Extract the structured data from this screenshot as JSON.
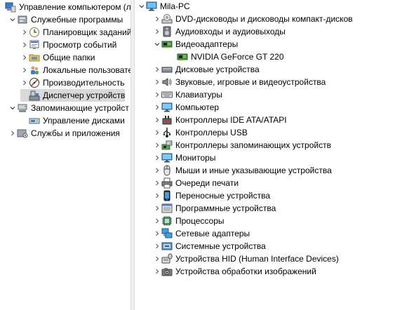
{
  "left_tree": [
    {
      "label": "Управление компьютером (л",
      "expander": "none",
      "icon": "computer-management-icon",
      "indent": 0,
      "selected": false
    },
    {
      "label": "Служебные программы",
      "expander": "expanded",
      "icon": "tools-icon",
      "indent": 1,
      "selected": false
    },
    {
      "label": "Планировщик заданий",
      "expander": "collapsed",
      "icon": "clock-icon",
      "indent": 2,
      "selected": false
    },
    {
      "label": "Просмотр событий",
      "expander": "collapsed",
      "icon": "event-viewer-icon",
      "indent": 2,
      "selected": false
    },
    {
      "label": "Общие папки",
      "expander": "collapsed",
      "icon": "shared-folder-icon",
      "indent": 2,
      "selected": false
    },
    {
      "label": "Локальные пользовате",
      "expander": "collapsed",
      "icon": "users-icon",
      "indent": 2,
      "selected": false
    },
    {
      "label": "Производительность",
      "expander": "collapsed",
      "icon": "performance-icon",
      "indent": 2,
      "selected": false
    },
    {
      "label": "Диспетчер устройств",
      "expander": "none",
      "icon": "device-manager-icon",
      "indent": 2,
      "selected": true
    },
    {
      "label": "Запоминающие устройст",
      "expander": "expanded",
      "icon": "storage-icon",
      "indent": 1,
      "selected": false
    },
    {
      "label": "Управление дисками",
      "expander": "none",
      "icon": "disk-management-icon",
      "indent": 2,
      "selected": false
    },
    {
      "label": "Службы и приложения",
      "expander": "collapsed",
      "icon": "services-icon",
      "indent": 1,
      "selected": false
    }
  ],
  "device_tree": [
    {
      "label": "Mila-PC",
      "expander": "expanded",
      "icon": "computer-icon",
      "indent": 0
    },
    {
      "label": "DVD-дисководы и дисководы компакт-дисков",
      "expander": "collapsed",
      "icon": "dvd-drive-icon",
      "indent": 1
    },
    {
      "label": "Аудиовходы и аудиовыходы",
      "expander": "collapsed",
      "icon": "speaker-icon",
      "indent": 1
    },
    {
      "label": "Видеоадаптеры",
      "expander": "expanded",
      "icon": "display-adapter-icon",
      "indent": 1
    },
    {
      "label": "NVIDIA GeForce GT 220",
      "expander": "none",
      "icon": "display-adapter-icon",
      "indent": 2
    },
    {
      "label": "Дисковые устройства",
      "expander": "collapsed",
      "icon": "disk-drive-icon",
      "indent": 1
    },
    {
      "label": "Звуковые, игровые и видеоустройства",
      "expander": "collapsed",
      "icon": "sound-icon",
      "indent": 1
    },
    {
      "label": "Клавиатуры",
      "expander": "collapsed",
      "icon": "keyboard-icon",
      "indent": 1
    },
    {
      "label": "Компьютер",
      "expander": "collapsed",
      "icon": "monitor-icon",
      "indent": 1
    },
    {
      "label": "Контроллеры IDE ATA/ATAPI",
      "expander": "collapsed",
      "icon": "ide-controller-icon",
      "indent": 1
    },
    {
      "label": "Контроллеры USB",
      "expander": "collapsed",
      "icon": "usb-icon",
      "indent": 1
    },
    {
      "label": "Контроллеры запоминающих устройств",
      "expander": "collapsed",
      "icon": "storage-controller-icon",
      "indent": 1
    },
    {
      "label": "Мониторы",
      "expander": "collapsed",
      "icon": "monitor-icon",
      "indent": 1
    },
    {
      "label": "Мыши и иные указывающие устройства",
      "expander": "collapsed",
      "icon": "mouse-icon",
      "indent": 1
    },
    {
      "label": "Очереди печати",
      "expander": "collapsed",
      "icon": "printer-icon",
      "indent": 1
    },
    {
      "label": "Переносные устройства",
      "expander": "collapsed",
      "icon": "portable-device-icon",
      "indent": 1
    },
    {
      "label": "Программные устройства",
      "expander": "collapsed",
      "icon": "software-device-icon",
      "indent": 1
    },
    {
      "label": "Процессоры",
      "expander": "collapsed",
      "icon": "processor-icon",
      "indent": 1
    },
    {
      "label": "Сетевые адаптеры",
      "expander": "collapsed",
      "icon": "network-adapter-icon",
      "indent": 1
    },
    {
      "label": "Системные устройства",
      "expander": "collapsed",
      "icon": "system-device-icon",
      "indent": 1
    },
    {
      "label": "Устройства HID (Human Interface Devices)",
      "expander": "collapsed",
      "icon": "hid-icon",
      "indent": 1
    },
    {
      "label": "Устройства обработки изображений",
      "expander": "collapsed",
      "icon": "imaging-device-icon",
      "indent": 1
    }
  ]
}
